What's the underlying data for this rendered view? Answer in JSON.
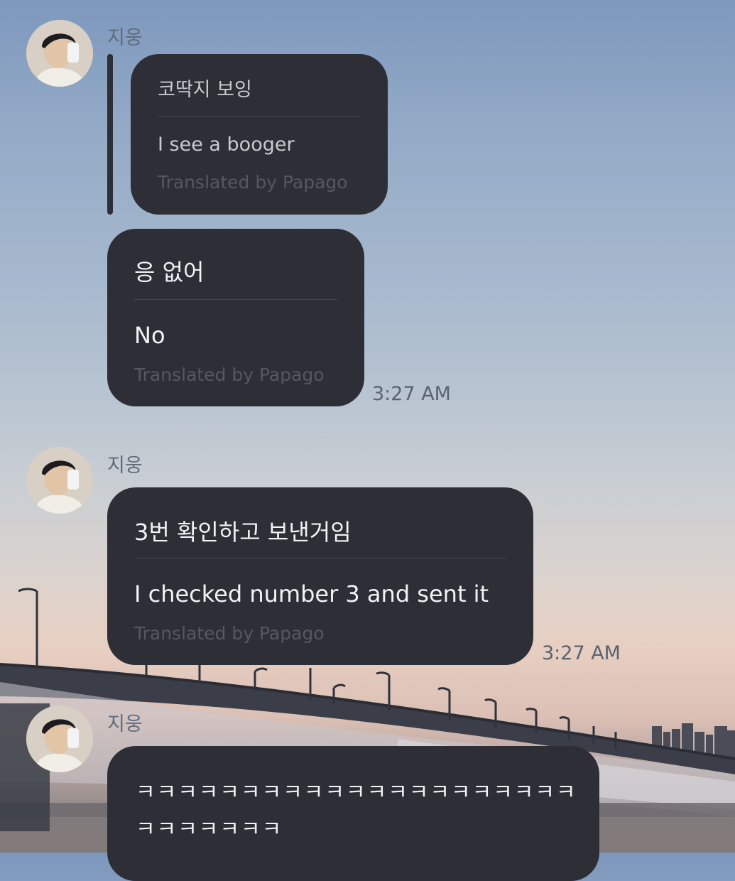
{
  "messages": [
    {
      "sender": "지웅",
      "quote": {
        "original": "코딱지 보잉",
        "translation": "I see a booger",
        "credit": "Translated by Papago"
      },
      "reply": {
        "original": "응 없어",
        "translation": "No",
        "credit": "Translated by Papago"
      },
      "time": "3:27 AM"
    },
    {
      "sender": "지웅",
      "original": "3번 확인하고 보낸거임",
      "translation": "I checked number 3 and sent it",
      "credit": "Translated by Papago",
      "time": "3:27 AM"
    },
    {
      "sender": "지웅",
      "lines": [
        "ㅋㅋㅋㅋㅋㅋㅋㅋㅋㅋㅋㅋㅋㅋㅋㅋㅋㅋㅋㅋㅋ",
        "ㅋㅋㅋㅋㅋㅋㅋ"
      ]
    }
  ],
  "icons": {
    "avatar": "profile-photo"
  },
  "colors": {
    "bubble": "#2e2f36",
    "credit": "#55585f",
    "time": "#5a6270",
    "sender": "#5f6b7d"
  }
}
